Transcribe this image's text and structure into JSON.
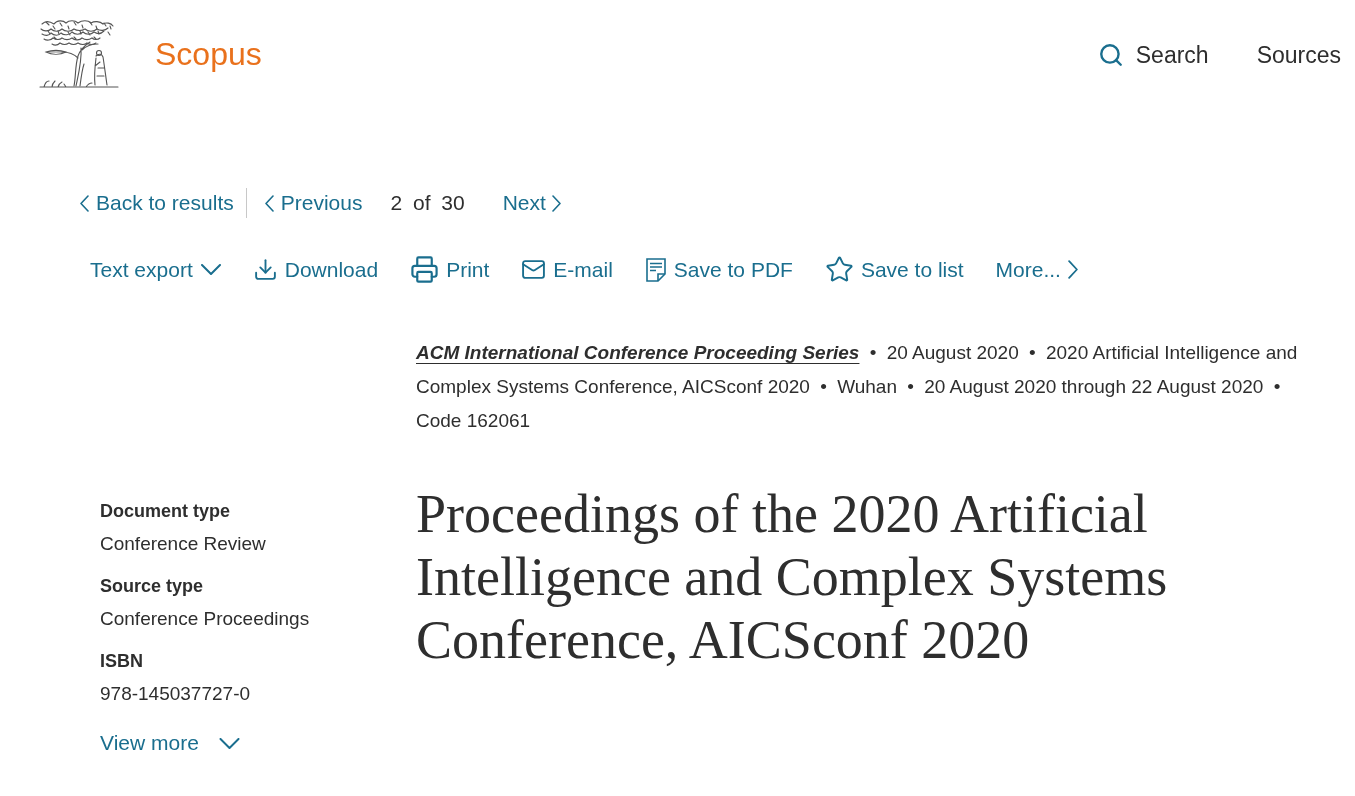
{
  "header": {
    "brand": "Scopus",
    "nav": [
      {
        "label": "Search",
        "kind": "search"
      },
      {
        "label": "Sources",
        "kind": "sources"
      }
    ]
  },
  "pager": {
    "back": "Back to results",
    "previous": "Previous",
    "position": "2 of 30",
    "next": "Next"
  },
  "toolbar": [
    {
      "label": "Text export",
      "kind": "export"
    },
    {
      "label": "Download",
      "kind": "download"
    },
    {
      "label": "Print",
      "kind": "print"
    },
    {
      "label": "E-mail",
      "kind": "email"
    },
    {
      "label": "Save to PDF",
      "kind": "pdf"
    },
    {
      "label": "Save to list",
      "kind": "save"
    },
    {
      "label": "More...",
      "kind": "more"
    }
  ],
  "source": {
    "series": "ACM International Conference Proceeding Series",
    "details": [
      {
        "separator": "•",
        "text": "20 August 2020"
      },
      {
        "separator": "•",
        "text": "2020 Artificial Intelligence and Complex Systems Conference, AICSconf 2020"
      },
      {
        "separator": "•",
        "text": "Wuhan"
      },
      {
        "separator": "•",
        "text": "20 August 2020 through 22 August 2020"
      },
      {
        "separator": "•",
        "text": "Code 162061"
      }
    ]
  },
  "document_info": [
    {
      "label": "Document type",
      "value": "Conference Review"
    },
    {
      "label": "Source type",
      "value": "Conference Proceedings"
    },
    {
      "label": "ISBN",
      "value": "978-145037727-0"
    }
  ],
  "view_more": "View more",
  "title": "Proceedings of the 2020 Artificial Intelligence and Complex Systems Conference, AICSconf 2020"
}
